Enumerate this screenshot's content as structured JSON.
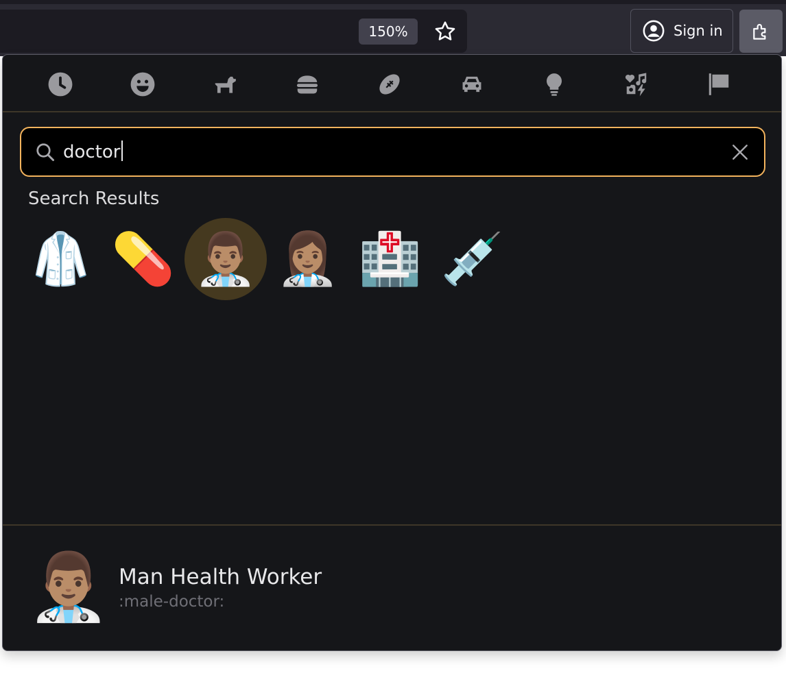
{
  "browser": {
    "zoom_level": "150%",
    "sign_in_label": "Sign in"
  },
  "emoji_picker": {
    "categories": [
      {
        "name": "Frequently Used",
        "icon": "clock-icon"
      },
      {
        "name": "Smileys & People",
        "icon": "smiley-icon"
      },
      {
        "name": "Animals & Nature",
        "icon": "dog-icon"
      },
      {
        "name": "Food & Drink",
        "icon": "burger-icon"
      },
      {
        "name": "Activity",
        "icon": "football-icon"
      },
      {
        "name": "Travel & Places",
        "icon": "car-icon"
      },
      {
        "name": "Objects",
        "icon": "lightbulb-icon"
      },
      {
        "name": "Symbols",
        "icon": "symbols-icon"
      },
      {
        "name": "Flags",
        "icon": "flag-icon"
      }
    ],
    "search": {
      "value": "doctor"
    },
    "results_title": "Search Results",
    "results": [
      {
        "emoji": "🥼",
        "name": "lab-coat"
      },
      {
        "emoji": "💊",
        "name": "pill"
      },
      {
        "emoji": "👨🏽‍⚕️",
        "name": "male-doctor",
        "selected": true
      },
      {
        "emoji": "👩🏽‍⚕️",
        "name": "female-doctor"
      },
      {
        "emoji": "🏥",
        "name": "hospital"
      },
      {
        "emoji": "💉",
        "name": "syringe"
      }
    ],
    "preview": {
      "emoji": "👨🏽‍⚕️",
      "name": "Man Health Worker",
      "shortcode": ":male-doctor:"
    }
  },
  "colors": {
    "accent": "#f3b35d",
    "panel_bg": "#151619",
    "selected_bg": "#45391f"
  }
}
